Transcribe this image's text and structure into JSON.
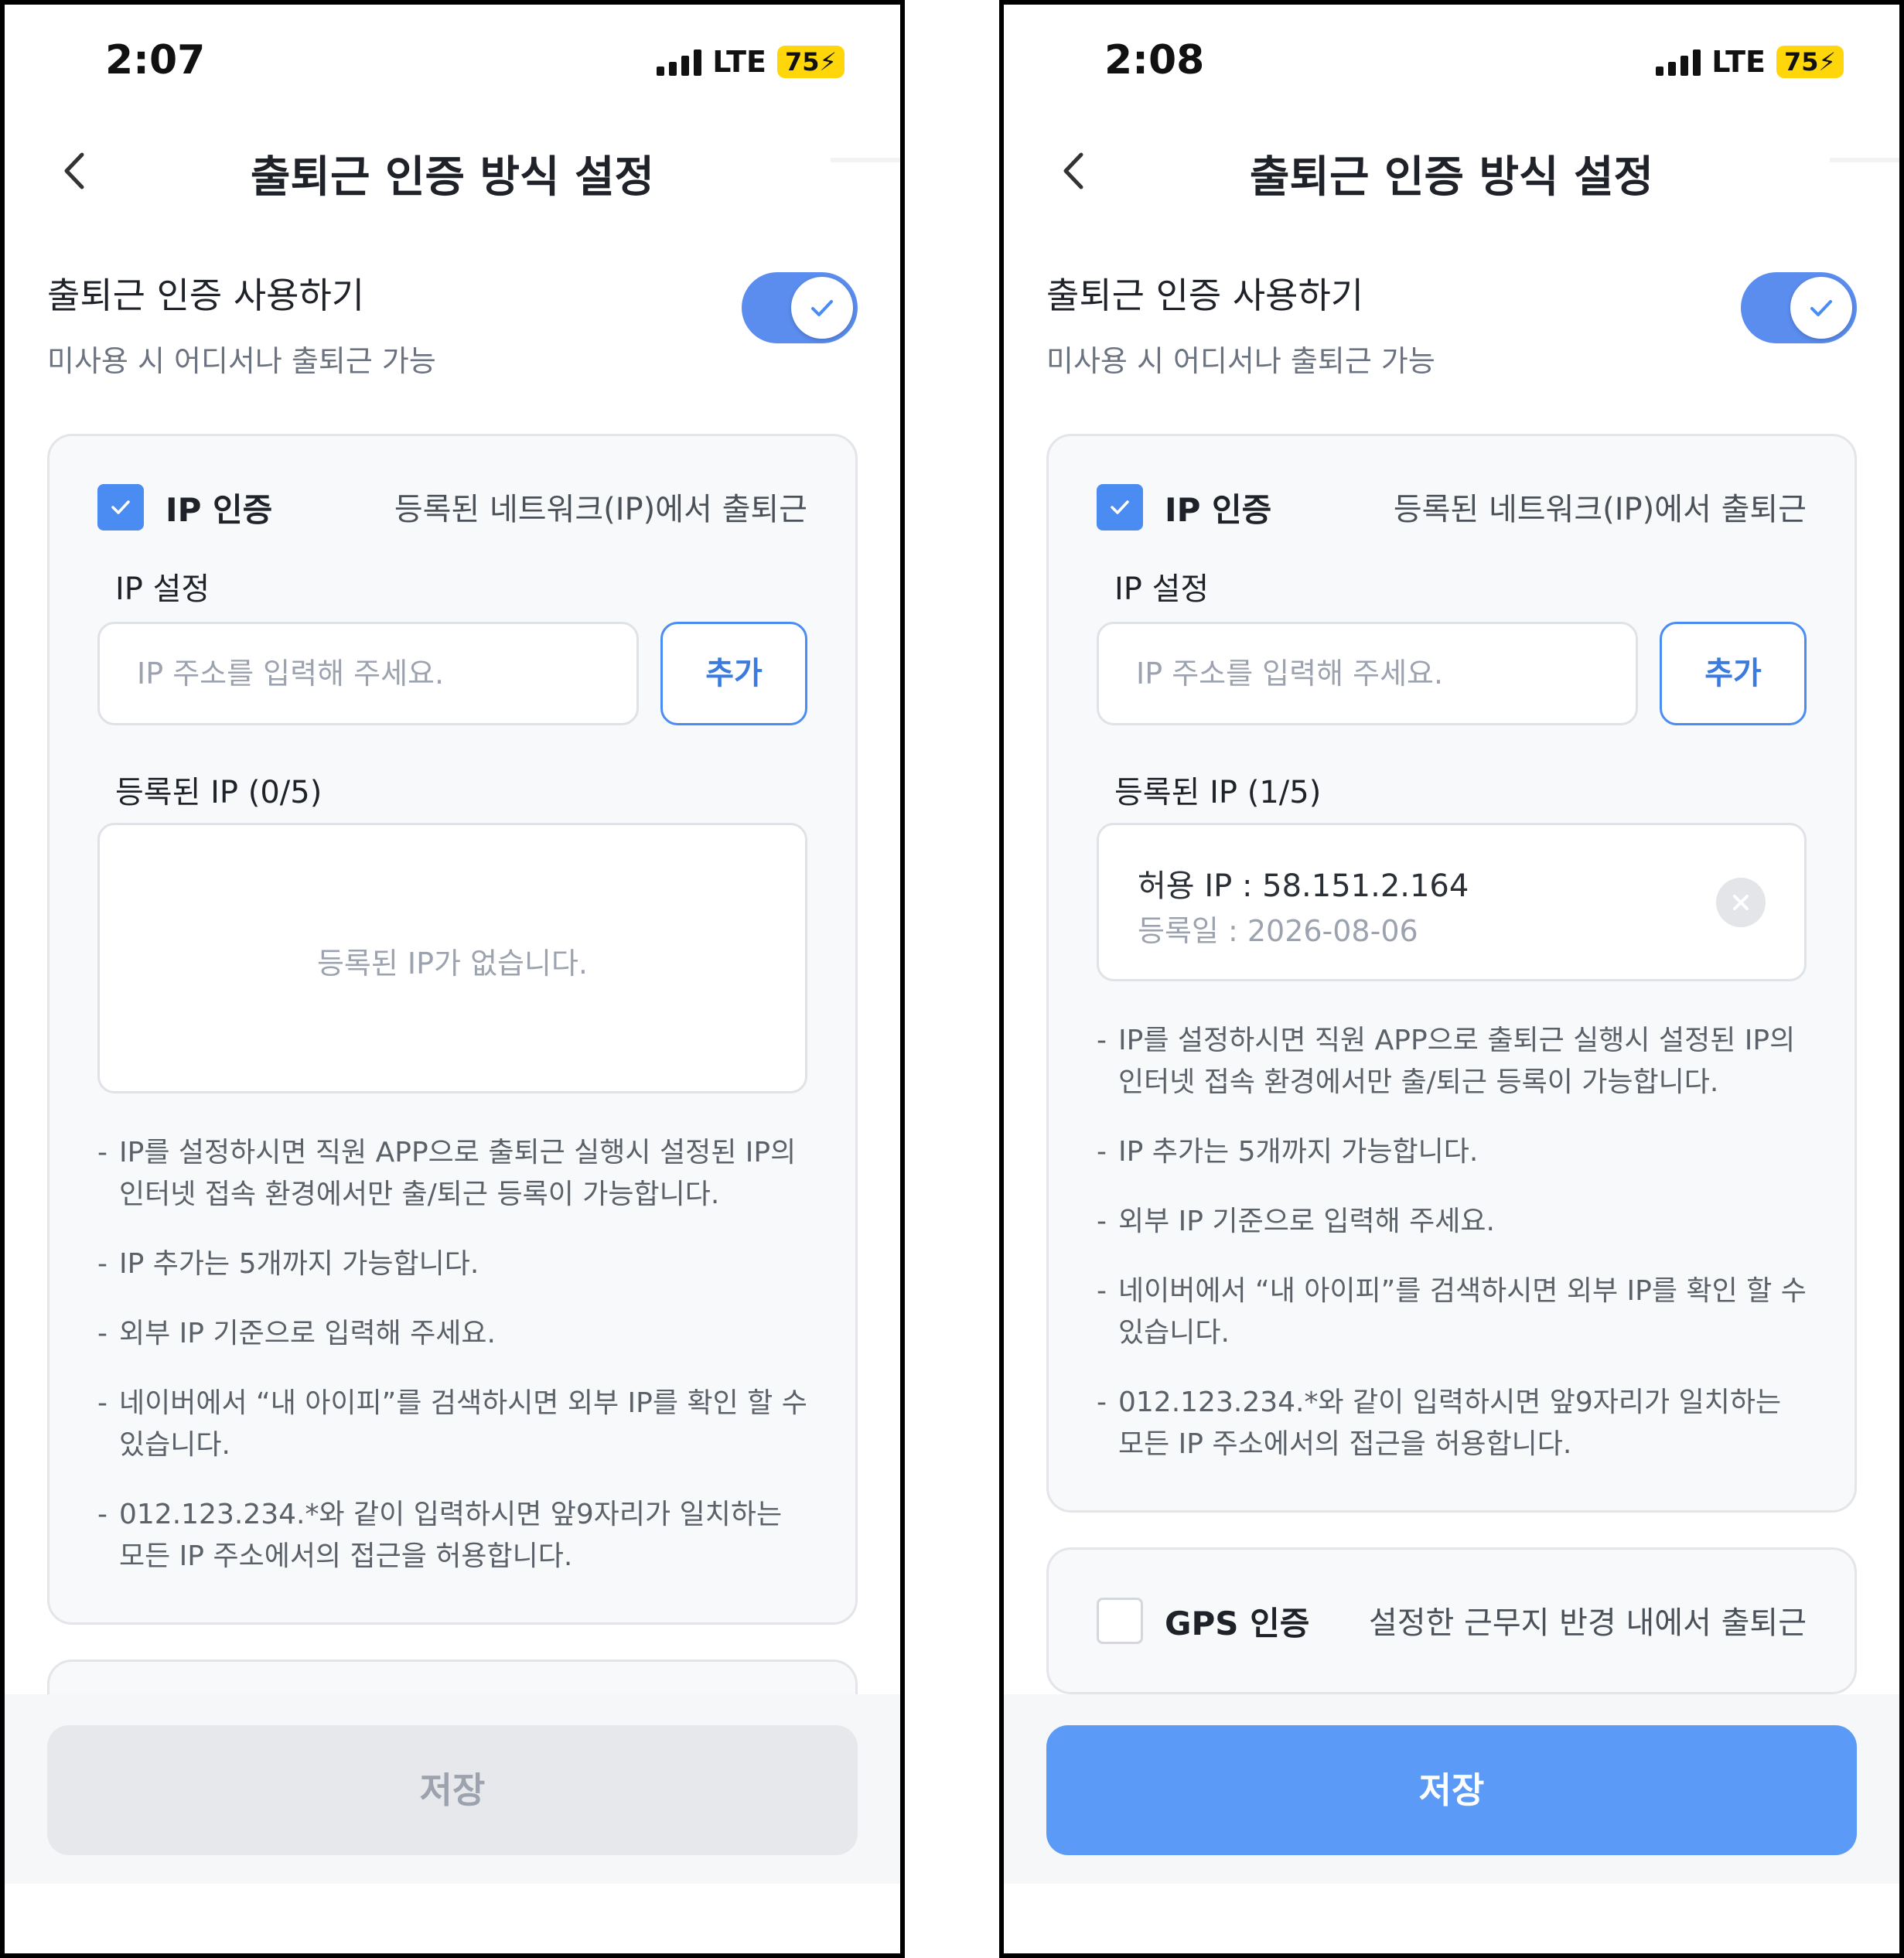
{
  "left": {
    "status": {
      "time": "2:07",
      "network": "LTE",
      "battery": "75"
    },
    "nav": {
      "title": "출퇴근 인증 방식 설정"
    },
    "toggle": {
      "title": "출퇴근 인증 사용하기",
      "subtitle": "미사용 시 어디서나 출퇴근 가능",
      "on": true
    },
    "ip_card": {
      "label": "IP 인증",
      "desc": "등록된 네트워크(IP)에서 출퇴근",
      "ip_setting_label": "IP 설정",
      "input_placeholder": "IP 주소를 입력해 주세요.",
      "add_label": "추가",
      "registered_label": "등록된 IP (0/5)",
      "empty_text": "등록된 IP가 없습니다.",
      "notes": [
        "IP를 설정하시면 직원 APP으로 출퇴근 실행시 설정된 IP의 인터넷 접속 환경에서만 출/퇴근 등록이 가능합니다.",
        "IP 추가는 5개까지 가능합니다.",
        "외부 IP 기준으로 입력해 주세요.",
        "네이버에서 “내 아이피”를 검색하시면 외부 IP를 확인 할 수 있습니다.",
        "012.123.234.*와 같이 입력하시면 앞9자리가 일치하는 모든 IP 주소에서의 접근을 허용합니다."
      ]
    },
    "save_label": "저장"
  },
  "right": {
    "status": {
      "time": "2:08",
      "network": "LTE",
      "battery": "75"
    },
    "nav": {
      "title": "출퇴근 인증 방식 설정"
    },
    "toggle": {
      "title": "출퇴근 인증 사용하기",
      "subtitle": "미사용 시 어디서나 출퇴근 가능",
      "on": true
    },
    "ip_card": {
      "label": "IP 인증",
      "desc": "등록된 네트워크(IP)에서 출퇴근",
      "ip_setting_label": "IP 설정",
      "input_placeholder": "IP 주소를 입력해 주세요.",
      "add_label": "추가",
      "registered_label": "등록된 IP (1/5)",
      "registered": [
        {
          "ip": "허용 IP : 58.151.2.164",
          "date": "등록일 : 2026-08-06"
        }
      ],
      "notes": [
        "IP를 설정하시면 직원 APP으로 출퇴근 실행시 설정된 IP의 인터넷 접속 환경에서만 출/퇴근 등록이 가능합니다.",
        "IP 추가는 5개까지 가능합니다.",
        "외부 IP 기준으로 입력해 주세요.",
        "네이버에서 “내 아이피”를 검색하시면 외부 IP를 확인 할 수 있습니다.",
        "012.123.234.*와 같이 입력하시면 앞9자리가 일치하는 모든 IP 주소에서의 접근을 허용합니다."
      ]
    },
    "gps_card": {
      "label": "GPS 인증",
      "desc": "설정한 근무지 반경 내에서 출퇴근",
      "checked": false
    },
    "save_label": "저장"
  },
  "colors": {
    "accent": "#4b8cf2",
    "save_active": "#5b9bf7",
    "save_disabled": "#e6e8eb",
    "battery": "#ffd60a"
  }
}
